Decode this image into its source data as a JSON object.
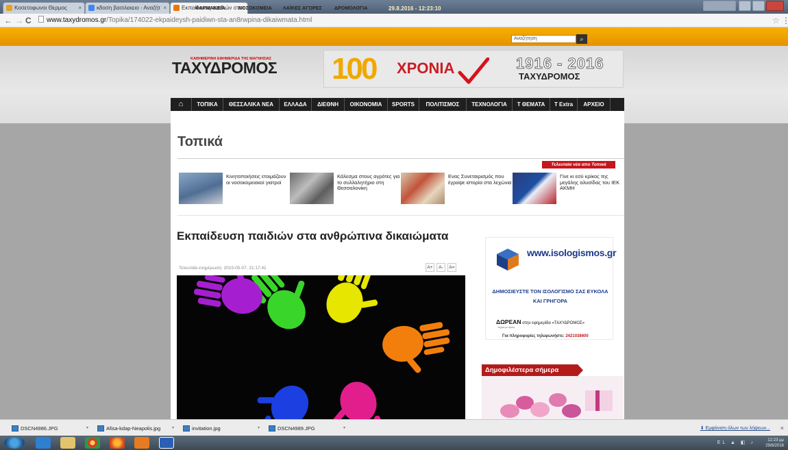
{
  "browser": {
    "tabs": [
      {
        "label": "Κοσετοφωνοι Θερμος",
        "color": "#e5a31f"
      },
      {
        "label": "κδοση βασιλεκειο - Αναζήτ",
        "color": "#4285f4"
      },
      {
        "label": "Εκπαίδευση παιδιών στο",
        "color": "#e8770d"
      }
    ],
    "url_domain": "www.taxydromos.gr",
    "url_path": "/Topika/174022-ekpaideysh-paidiwn-sta-an8rwpina-dikaiwmata.html"
  },
  "site": {
    "top_menu": [
      "ΦΑΡΜΑΚΕΙΑ",
      "ΝΟΣΟΚΟΜΕΙΑ",
      "ΛΑΪΚΕΣ ΑΓΟΡΕΣ",
      "ΔΡΟΜΟΛΟΓΙΑ"
    ],
    "datetime": "29.8.2016 - 12:23:10",
    "search_placeholder": "Αναζήτηση",
    "logo_kicker": "ΚΑΘΗΜΕΡΙΝΗ ΕΦΗΜΕΡΙΔΑ ΤΗΣ ΜΑΓΝΗΣΙΑΣ",
    "logo": "ΤΑΧΥΔΡΟΜΟΣ",
    "banner": {
      "big": "100",
      "word": "ΧΡΟΝΙΑ",
      "years": "1916 - 2016",
      "name": "ΤΑΧΥΔΡΟΜΟΣ"
    },
    "nav": [
      "ΤΟΠΙΚΑ",
      "ΘΕΣΣΑΛΙΚΑ ΝΕΑ",
      "ΕΛΛΑΔΑ",
      "ΔΙΕΘΝΗ",
      "ΟΙΚΟΝΟΜΙΑ",
      "SPORTS",
      "ΠΟΛΙΤΙΣΜΟΣ",
      "ΤΕΧΝΟΛΟΓΙΑ",
      "Τ ΘΕΜΑΤΑ",
      "Τ Extra",
      "ΑΡΧΕΙΟ"
    ]
  },
  "section": {
    "title": "Τοπικά",
    "latest_label": "Τελευταία νέα απο Τοπικά",
    "latest": [
      {
        "text": "Κινητοποιήσεις ετοιμάζουν οι νοσοκομειακοί γιατροί"
      },
      {
        "text": "Κάλεσμα στους αγρότες για το συλλαλητήριο στη Θεσσαλονίκη"
      },
      {
        "text": "Ενας Συνεταιρισμός που έγραψε ιστορία στα λεχώνια"
      },
      {
        "text": "Γίνε κι εσύ κρίκος της μεγάλης αλυσίδας του ΙΕΚ ΑΚΜΗ"
      }
    ]
  },
  "article": {
    "title": "Εκπαίδευση παιδιών στα ανθρώπινα δικαιώματα",
    "updated": "Τελευταία ενημέρωση: 2015-05-07, 21:17:41",
    "font_buttons": [
      "A+",
      "A-",
      "A="
    ]
  },
  "ad": {
    "url": "www.isologismos.gr",
    "line1": "ΔΗΜΟΣΙΕΥΣΤΕ ΤΟΝ ΙΣΟΛΟΓΙΣΜΟ ΣΑΣ ΕΥΚΟΛΑ ΚΑΙ ΓΡΗΓΟΡΑ",
    "line2_bold": "ΔΩΡΕΑΝ",
    "line2_rest": " στην εφημερίδα «ΤΑΧΥΔΡΟΜΟΣ»",
    "fineprint": "*ισχύει με όρους",
    "contact_label": "Για πληροφορίες τηλεφωνήστε: ",
    "phone": "2421038600"
  },
  "popular_label": "Δημοφιλέστερα σήμερα",
  "downloads": {
    "files": [
      "DSCN4986.JPG",
      "Afisa-kdap-Neapolis.jpg",
      "invitation.jpg",
      "DSCN4989.JPG"
    ],
    "show_all": "Εμφάνιση όλων των λήψεων..."
  },
  "taskbar": {
    "time": "12:23 μμ",
    "date": "29/8/2016",
    "lang": "EL"
  }
}
